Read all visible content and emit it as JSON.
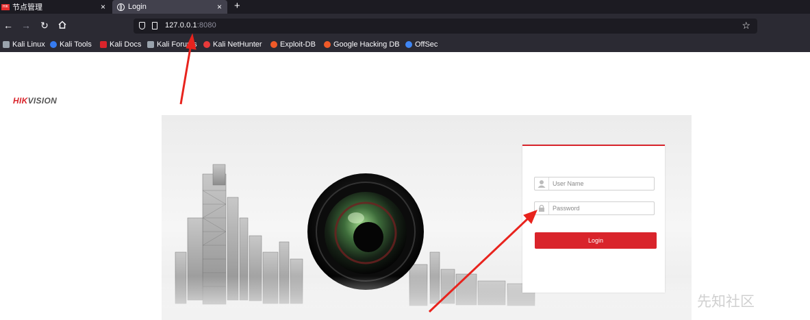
{
  "browser": {
    "tabs": [
      {
        "label": "节点管理",
        "favicon": "hikvision-favicon",
        "active": false
      },
      {
        "label": "Login",
        "favicon": "globe-icon",
        "active": true
      }
    ],
    "tab_close_glyph": "×",
    "new_tab_glyph": "+",
    "url": {
      "host": "127.0.0.1",
      "port": ":8080"
    },
    "bookmarks": [
      {
        "label": "Kali Linux",
        "icon": "kali-dragon-icon",
        "color": "#9aa3ad"
      },
      {
        "label": "Kali Tools",
        "icon": "kali-tools-icon",
        "color": "#367bf0"
      },
      {
        "label": "Kali Docs",
        "icon": "kali-docs-icon",
        "color": "#d9242b"
      },
      {
        "label": "Kali Forums",
        "icon": "kali-forums-icon",
        "color": "#9aa3ad"
      },
      {
        "label": "Kali NetHunter",
        "icon": "nethunter-icon",
        "color": "#e83a3a"
      },
      {
        "label": "Exploit-DB",
        "icon": "exploit-db-icon",
        "color": "#f05a28"
      },
      {
        "label": "Google Hacking DB",
        "icon": "ghdb-icon",
        "color": "#f05a28"
      },
      {
        "label": "OffSec",
        "icon": "offsec-icon",
        "color": "#3f86f4"
      }
    ]
  },
  "page": {
    "logo": {
      "part1": "HIK",
      "part2": "VISION"
    },
    "login": {
      "username_placeholder": "User Name",
      "password_placeholder": "Password",
      "login_button": "Login"
    },
    "watermark": "先知社区"
  },
  "colors": {
    "brand_red": "#d9242b",
    "annotation_arrow": "#e8231d"
  }
}
